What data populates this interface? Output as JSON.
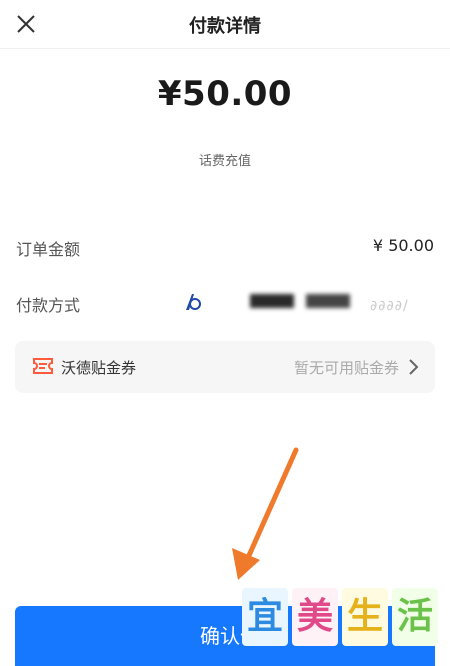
{
  "header": {
    "title": "付款详情",
    "close_icon": "close-icon"
  },
  "payment": {
    "amount": "¥50.00",
    "category": "话费充值",
    "order_label": "订单金额",
    "order_value": "¥ 50.00",
    "method_label": "付款方式",
    "method_value_visible": "∂∂∂∂/"
  },
  "coupon": {
    "label": "沃德贴金券",
    "value": "暂无可用贴金券",
    "icon": "ticket-icon"
  },
  "confirm": {
    "label": "确认付"
  },
  "watermark": {
    "chars": [
      "宜",
      "美",
      "生",
      "活"
    ]
  },
  "colors": {
    "primary": "#1677ff",
    "coupon_icon": "#ff5a3c",
    "arrow": "#f07a2b"
  }
}
